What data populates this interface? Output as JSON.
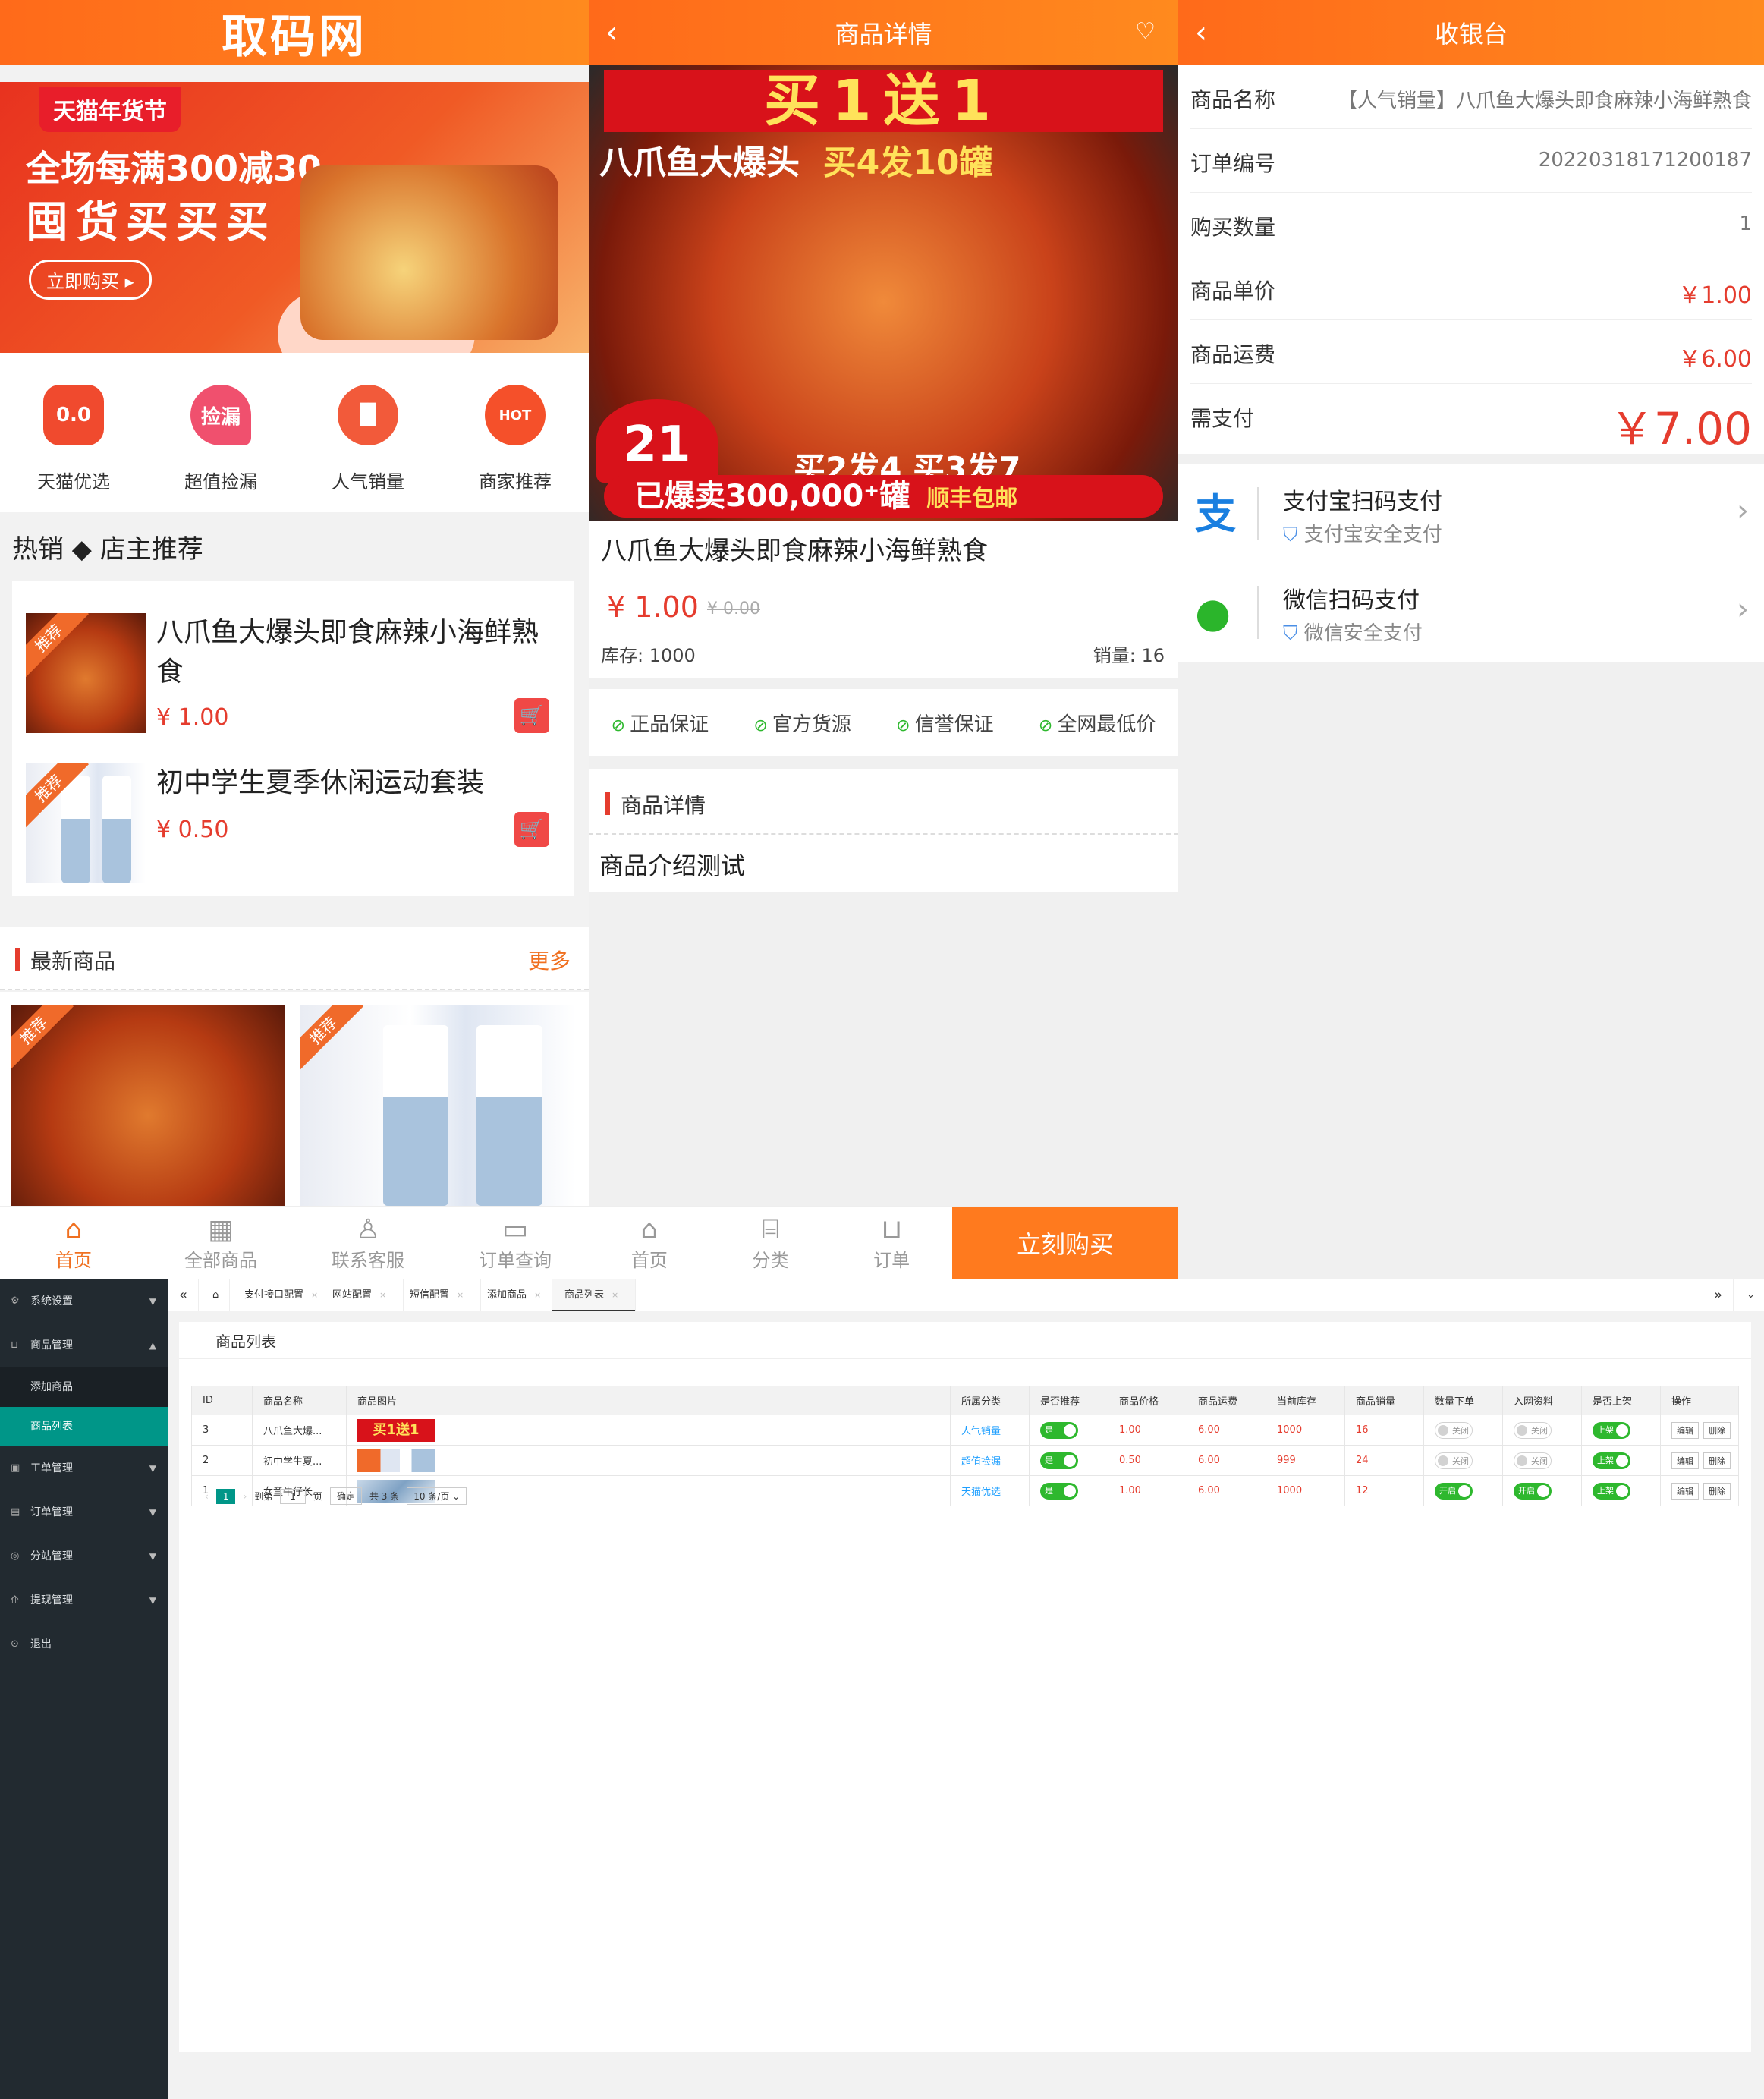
{
  "home": {
    "logo": "取码网",
    "banner": {
      "tag": "天猫年货节",
      "line1": "全场每满300减30",
      "line2": "囤货买买买",
      "button": "立即购买"
    },
    "categories": [
      {
        "label": "天猫优选",
        "icon": "tmall-cat-icon",
        "color": "#f04a2e",
        "glyph": "0.0"
      },
      {
        "label": "超值捡漏",
        "icon": "bargain-icon",
        "color": "#f0506e",
        "glyph": "捡漏"
      },
      {
        "label": "人气销量",
        "icon": "bar-chart-icon",
        "color": "#f25a3a",
        "glyph": "▐▌"
      },
      {
        "label": "商家推荐",
        "icon": "hot-fire-icon",
        "color": "#f5502a",
        "glyph": "HOT"
      }
    ],
    "hot_title": "热销 ◆ 店主推荐",
    "ribbon": "推荐",
    "hot_items": [
      {
        "name": "八爪鱼大爆头即食麻辣小海鲜熟食",
        "price": "¥ 1.00"
      },
      {
        "name": "初中学生夏季休闲运动套装",
        "price": "¥ 0.50"
      }
    ],
    "new_title": "最新商品",
    "more": "更多",
    "tabs": [
      "首页",
      "全部商品",
      "联系客服",
      "订单查询"
    ]
  },
  "detail": {
    "title": "商品详情",
    "img_h1": "买1送1",
    "img_h2a": "八爪鱼大爆头",
    "img_h2b": "买4发10罐",
    "img_badge": "21",
    "img_h3": "买2发4 买3发7",
    "img_h4": "已爆卖300,000⁺罐",
    "img_h4b": "顺丰包邮",
    "name": "八爪鱼大爆头即食麻辣小海鲜熟食",
    "price": "¥ 1.00",
    "orig_price": "¥ 0.00",
    "stock": "库存: 1000",
    "sales": "销量: 16",
    "guarantees": [
      "正品保证",
      "官方货源",
      "信誉保证",
      "全网最低价"
    ],
    "section": "商品详情",
    "desc": "商品介绍测试",
    "tabs": [
      "首页",
      "分类",
      "订单"
    ],
    "buy": "立刻购买"
  },
  "checkout": {
    "title": "收银台",
    "rows": [
      {
        "k": "商品名称",
        "v": "【人气销量】八爪鱼大爆头即食麻辣小海鲜熟食"
      },
      {
        "k": "订单编号",
        "v": "2022031817120018​7"
      },
      {
        "k": "购买数量",
        "v": "1"
      },
      {
        "k": "商品单价",
        "v": "￥1.00"
      },
      {
        "k": "商品运费",
        "v": "￥6.00"
      }
    ],
    "total_label": "需支付",
    "total": "￥7.00",
    "alipay": {
      "title": "支付宝扫码支付",
      "sub": "支付宝安全支付"
    },
    "wechat": {
      "title": "微信扫码支付",
      "sub": "微信安全支付"
    }
  },
  "admin": {
    "menu": [
      {
        "label": "系统设置"
      },
      {
        "label": "商品管理"
      },
      {
        "label": "工单管理"
      },
      {
        "label": "订单管理"
      },
      {
        "label": "分站管理"
      },
      {
        "label": "提现管理"
      },
      {
        "label": "退出"
      }
    ],
    "submenu": [
      "添加商品",
      "商品列表"
    ],
    "tabs": [
      "支付接口配置",
      "网站配置",
      "短信配置",
      "添加商品",
      "商品列表"
    ],
    "card_title": "商品列表",
    "columns": [
      "ID",
      "商品名称",
      "商品图片",
      "所属分类",
      "是否推荐",
      "商品价格",
      "商品运费",
      "当前库存",
      "商品销量",
      "数量下单",
      "入网资料",
      "是否上架",
      "操作"
    ],
    "rows": [
      {
        "id": "3",
        "name": "八爪鱼大爆...",
        "cat": "人气销量",
        "rec": "是",
        "price": "1.00",
        "ship": "6.00",
        "stock": "1000",
        "sales": "16",
        "qty": "关闭",
        "net": "关闭",
        "shelf": "上架",
        "img_label": "买1送1"
      },
      {
        "id": "2",
        "name": "初中学生夏...",
        "cat": "超值捡漏",
        "rec": "是",
        "price": "0.50",
        "ship": "6.00",
        "stock": "999",
        "sales": "24",
        "qty": "关闭",
        "net": "关闭",
        "shelf": "上架",
        "img_label": ""
      },
      {
        "id": "1",
        "name": "女童牛仔长...",
        "cat": "天猫优选",
        "rec": "是",
        "price": "1.00",
        "ship": "6.00",
        "stock": "1000",
        "sales": "12",
        "qty": "开启",
        "net": "开启",
        "shelf": "上架",
        "img_label": ""
      }
    ],
    "edit": "编辑",
    "delete": "删除",
    "pager": {
      "page": "1",
      "goto": "到第",
      "page_unit": "页",
      "confirm": "确定",
      "total": "共 3 条",
      "per_page": "10 条/页"
    }
  }
}
